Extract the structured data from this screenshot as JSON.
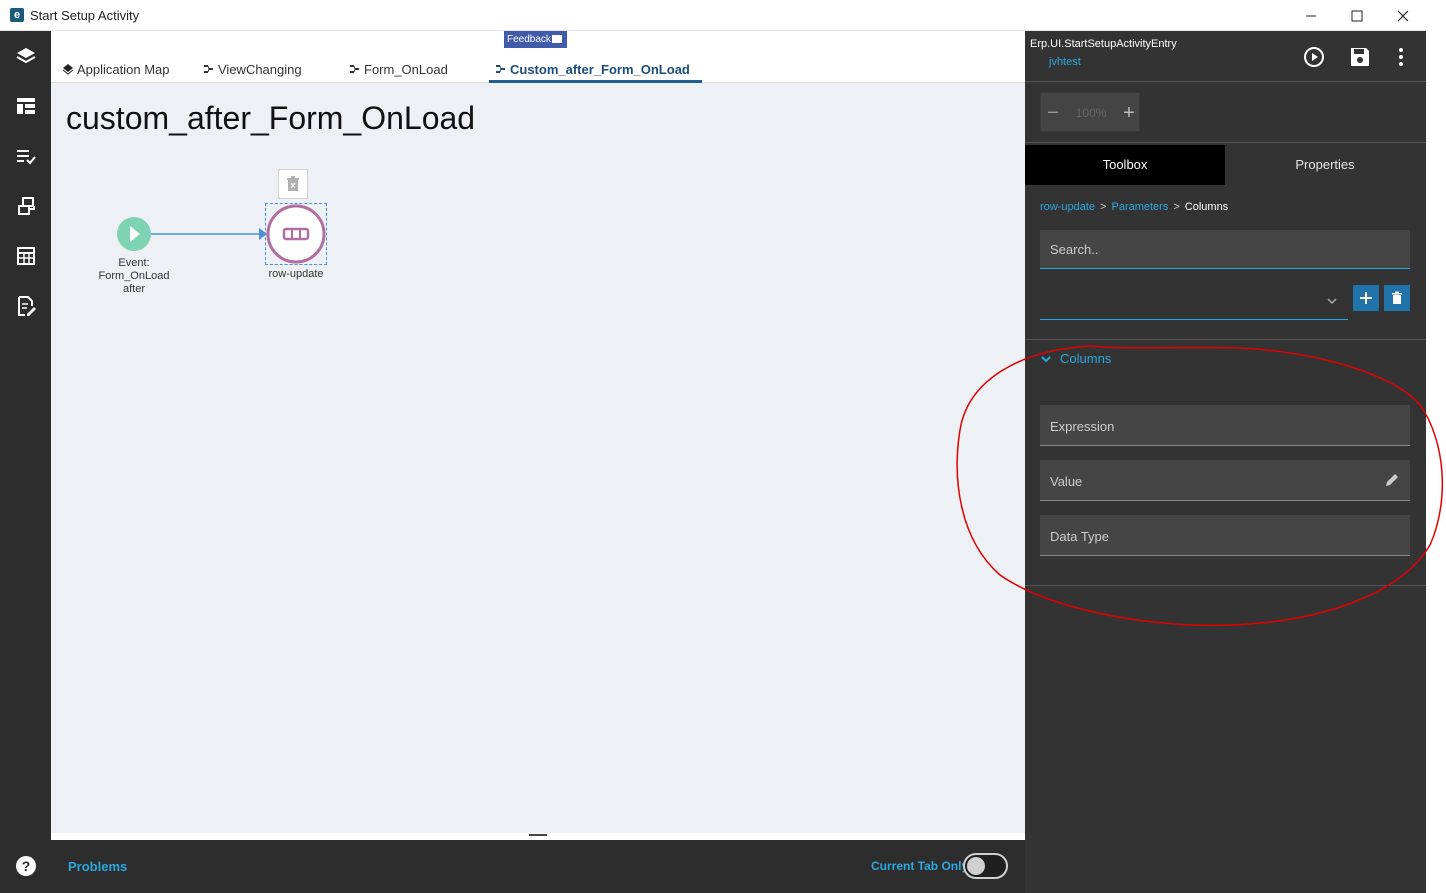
{
  "window": {
    "title": "Start Setup Activity"
  },
  "tabs": {
    "feedback_label": "Feedback",
    "items": [
      {
        "label": "Application Map"
      },
      {
        "label": "ViewChanging"
      },
      {
        "label": "Form_OnLoad"
      },
      {
        "label": "Custom_after_Form_OnLoad"
      }
    ]
  },
  "canvas": {
    "title": "custom_after_Form_OnLoad",
    "event_node_label_1": "Event:",
    "event_node_label_2": "Form_OnLoad",
    "event_node_label_3": "after",
    "action_node_label": "row-update"
  },
  "problems": {
    "label": "Problems",
    "current_tab_label": "Current Tab Only"
  },
  "right_panel": {
    "title": "Erp.UI.StartSetupActivityEntry",
    "subtitle": "jvhtest",
    "zoom_value": "100%",
    "tab_toolbox": "Toolbox",
    "tab_properties": "Properties",
    "breadcrumb": [
      "row-update",
      "Parameters",
      "Columns"
    ],
    "search_placeholder": "Search..",
    "section_title": "Columns",
    "fields": [
      {
        "label": "Expression"
      },
      {
        "label": "Value"
      },
      {
        "label": "Data Type"
      }
    ]
  },
  "colors": {
    "accent": "#2aa7e0",
    "dark_panel": "#333333",
    "nav_bg": "#2d2d2d",
    "canvas_bg": "#edf1f5",
    "annotation_red": "#e00000",
    "event_node": "#7ed3b2",
    "action_node": "#b06fa0"
  }
}
